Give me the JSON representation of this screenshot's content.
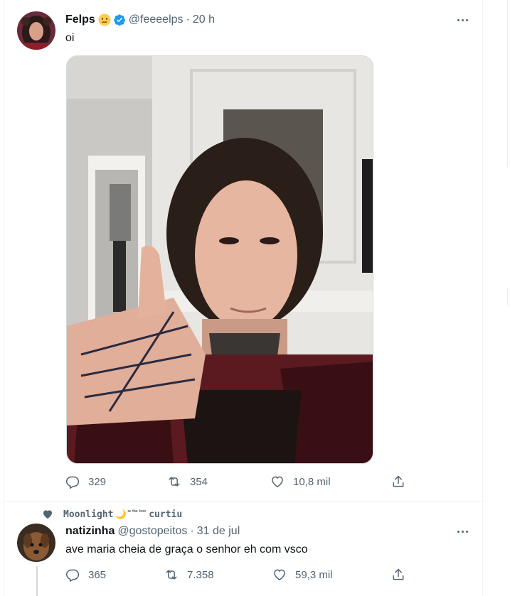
{
  "tweet1": {
    "author_name": "Felps",
    "author_emoji": "neutral-face-emoji",
    "handle": "@feeeelps",
    "separator": "·",
    "time": "20 h",
    "text": "oi",
    "replies": "329",
    "retweets": "354",
    "likes": "10,8 mil"
  },
  "social_context": {
    "liker_name": "Moonlight",
    "liker_suffix": "🌙",
    "liker_tiny": "ᶦᶰ ᵗʰᵉ ᵇᵒˣ",
    "action": "curtiu"
  },
  "tweet2": {
    "author_name": "natizinha",
    "handle": "@gostopeitos",
    "separator": "·",
    "time": "31 de jul",
    "text": "ave maria cheia de graça o senhor eh com vsco",
    "replies": "365",
    "retweets": "7.358",
    "likes": "59,3 mil"
  },
  "colors": {
    "text_primary": "#0f1419",
    "text_secondary": "#536471",
    "verified": "#1d9bf0",
    "border": "#eff3f4"
  }
}
